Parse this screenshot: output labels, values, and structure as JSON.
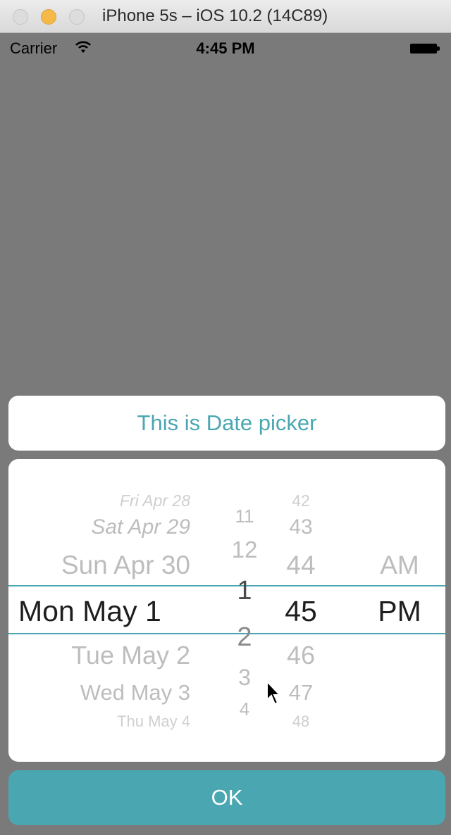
{
  "window": {
    "title": "iPhone 5s – iOS 10.2 (14C89)"
  },
  "status_bar": {
    "carrier": "Carrier",
    "time": "4:45 PM"
  },
  "dialog": {
    "title": "This is Date picker",
    "ok_label": "OK"
  },
  "picker": {
    "dates": [
      "Fri Apr 28",
      "Sat Apr 29",
      "Sun Apr 30",
      "Mon May 1",
      "Tue May 2",
      "Wed May 3",
      "Thu May 4"
    ],
    "hours": [
      "11",
      "12",
      "1",
      "2",
      "3",
      "4"
    ],
    "minutes": [
      "42",
      "43",
      "44",
      "45",
      "46",
      "47",
      "48"
    ],
    "ampm": [
      "AM",
      "PM"
    ],
    "selected": {
      "date": "Mon May 1",
      "minute": "45",
      "ampm": "PM"
    }
  },
  "colors": {
    "accent": "#4aa7b1",
    "backdrop": "#7a7a7a",
    "card": "#ffffff"
  }
}
